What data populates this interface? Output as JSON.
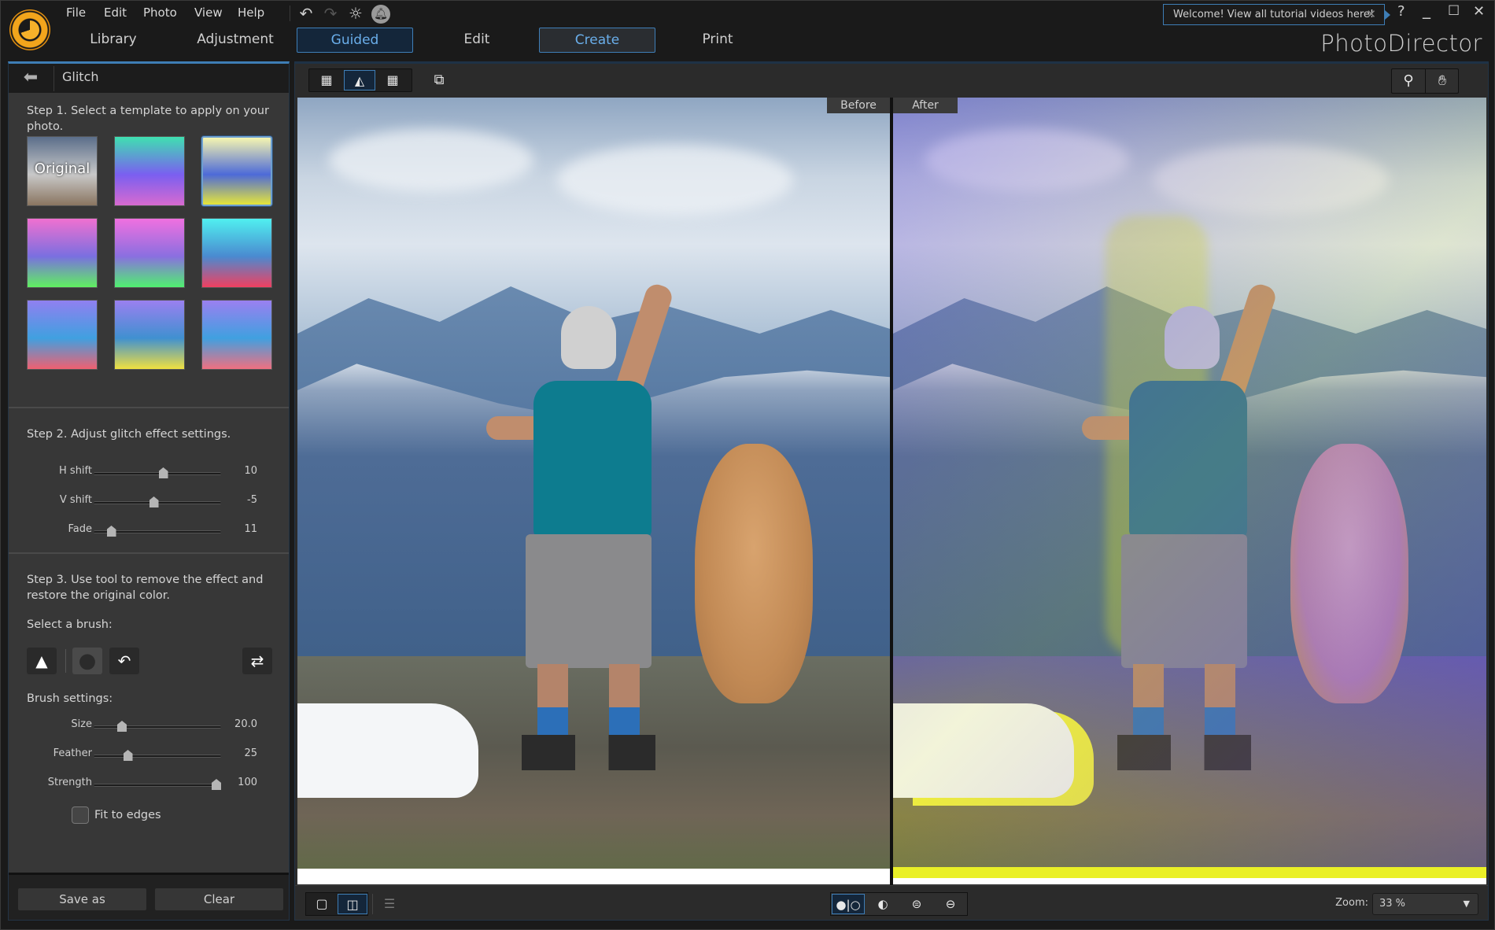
{
  "app": {
    "name": "PhotoDirector",
    "menu": [
      "File",
      "Edit",
      "Photo",
      "View",
      "Help"
    ],
    "tabs": [
      {
        "label": "Library",
        "state": "normal"
      },
      {
        "label": "Adjustment",
        "state": "normal"
      },
      {
        "label": "Guided",
        "state": "active"
      },
      {
        "label": "Edit",
        "state": "normal"
      },
      {
        "label": "Create",
        "state": "highlighted"
      },
      {
        "label": "Print",
        "state": "normal"
      }
    ],
    "welcome_tip": "Welcome! View all tutorial videos here!",
    "help_label": "?",
    "icons": {
      "undo": "undo-icon",
      "redo": "redo-icon",
      "settings": "gear-icon",
      "notifications": "bell-icon"
    }
  },
  "left_panel": {
    "title": "Glitch",
    "step1": "Step 1. Select a template to apply on your photo.",
    "templates": [
      {
        "label": "Original",
        "selected": false,
        "colors": [
          "#5b6e8a",
          "#c8c8c8",
          "#8a7560"
        ]
      },
      {
        "label": "",
        "selected": false,
        "colors": [
          "#3fe0b0",
          "#7a5ff0",
          "#d86ad0"
        ]
      },
      {
        "label": "",
        "selected": true,
        "colors": [
          "#f5f5b0",
          "#4d6ad8",
          "#e6e63a"
        ]
      },
      {
        "label": "",
        "selected": false,
        "colors": [
          "#f070d0",
          "#7a6fe0",
          "#60f060"
        ]
      },
      {
        "label": "",
        "selected": false,
        "colors": [
          "#f070e0",
          "#8a6fe0",
          "#50f070"
        ]
      },
      {
        "label": "",
        "selected": false,
        "colors": [
          "#50f0f0",
          "#4a8ad0",
          "#f04060"
        ]
      },
      {
        "label": "",
        "selected": false,
        "colors": [
          "#9080f0",
          "#40a0e0",
          "#f06070"
        ]
      },
      {
        "label": "",
        "selected": false,
        "colors": [
          "#9a80f0",
          "#4090d0",
          "#f0e040"
        ]
      },
      {
        "label": "",
        "selected": false,
        "colors": [
          "#9a80f0",
          "#40a0e0",
          "#f07080"
        ]
      }
    ],
    "step2": "Step 2. Adjust glitch effect settings.",
    "glitch_sliders": [
      {
        "name": "H shift",
        "value": "10",
        "fraction": 0.55
      },
      {
        "name": "V shift",
        "value": "-5",
        "fraction": 0.47
      },
      {
        "name": "Fade",
        "value": "11",
        "fraction": 0.11
      }
    ],
    "step3": "Step 3. Use tool to remove the effect and restore the original color.",
    "select_brush_label": "Select a brush:",
    "brushes": [
      {
        "name": "apply-effect-brush-icon",
        "glyph": "▲"
      },
      {
        "name": "eraser-brush-icon",
        "glyph": "●"
      },
      {
        "name": "restore-brush-icon",
        "glyph": "↶"
      }
    ],
    "swap_icon": "⇄",
    "brush_settings_label": "Brush settings:",
    "brush_sliders": [
      {
        "name": "Size",
        "value": "20.0",
        "fraction": 0.2
      },
      {
        "name": "Feather",
        "value": "25",
        "fraction": 0.25
      },
      {
        "name": "Strength",
        "value": "100",
        "fraction": 1.0
      }
    ],
    "fit_to_edges": {
      "label": "Fit to edges",
      "checked": false
    },
    "buttons": {
      "save_as": "Save as",
      "clear": "Clear"
    }
  },
  "main_view": {
    "before_label": "Before",
    "after_label": "After",
    "zoom_label": "Zoom:",
    "zoom_value": "33 %",
    "view_modes": [
      "filmstrip-view-icon",
      "single-view-icon",
      "grid-view-icon"
    ],
    "active_view_mode": 1,
    "tools": [
      "zoom-tool-icon",
      "hand-tool-icon"
    ],
    "compare_modes": [
      "side-by-side-icon",
      "split-vertical-icon",
      "top-bottom-icon",
      "split-horizontal-icon"
    ],
    "active_compare_mode": 0,
    "layouts": [
      "single-photo-icon",
      "compare-photo-icon"
    ],
    "active_layout": 1
  }
}
